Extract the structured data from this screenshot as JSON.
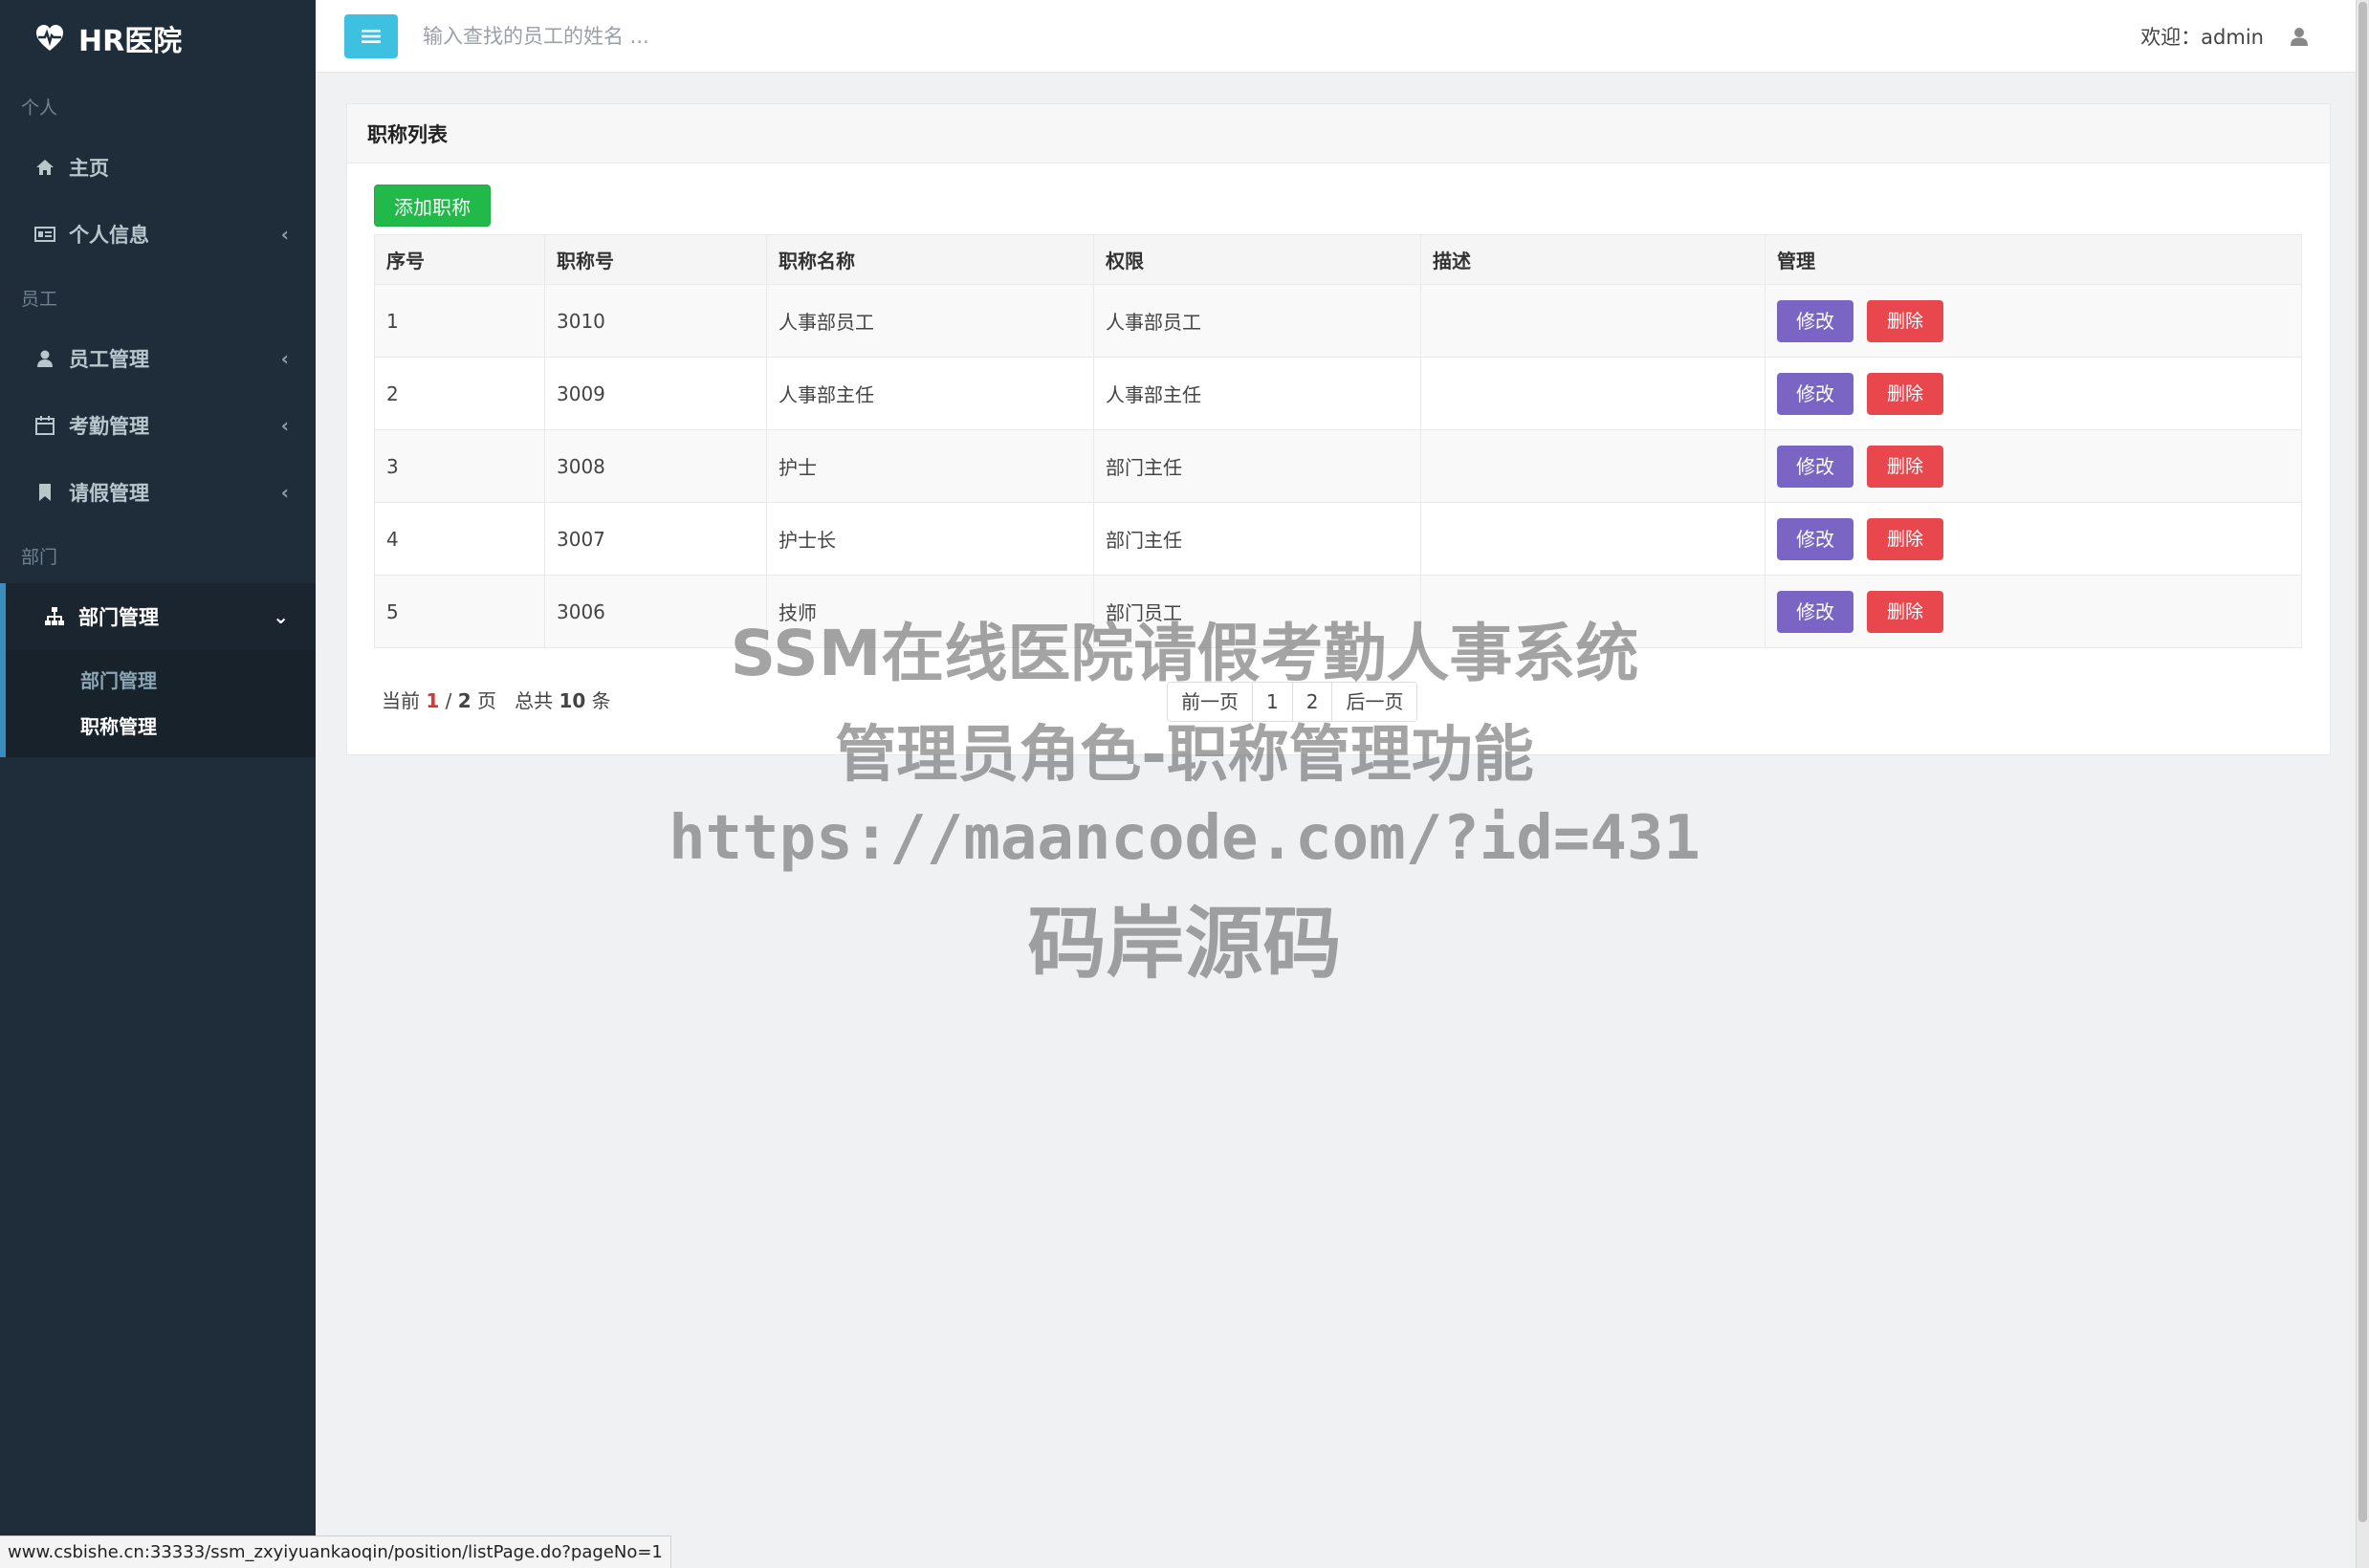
{
  "brand": {
    "title": "HR医院"
  },
  "sidebar": {
    "sections": [
      {
        "header": "个人",
        "items": [
          {
            "label": "主页"
          },
          {
            "label": "个人信息"
          }
        ]
      },
      {
        "header": "员工",
        "items": [
          {
            "label": "员工管理"
          },
          {
            "label": "考勤管理"
          },
          {
            "label": "请假管理"
          }
        ]
      },
      {
        "header": "部门",
        "items": [
          {
            "label": "部门管理"
          }
        ]
      }
    ],
    "submenu": [
      {
        "label": "部门管理"
      },
      {
        "label": "职称管理"
      }
    ]
  },
  "header": {
    "search_placeholder": "输入查找的员工的姓名 ...",
    "welcome": "欢迎：admin"
  },
  "box": {
    "title": "职称列表",
    "add_label": "添加职称"
  },
  "table": {
    "columns": [
      "序号",
      "职称号",
      "职称名称",
      "权限",
      "描述",
      "管理"
    ],
    "rows": [
      {
        "no": "1",
        "code": "3010",
        "name": "人事部员工",
        "role": "人事部员工",
        "desc": ""
      },
      {
        "no": "2",
        "code": "3009",
        "name": "人事部主任",
        "role": "人事部主任",
        "desc": ""
      },
      {
        "no": "3",
        "code": "3008",
        "name": "护士",
        "role": "部门主任",
        "desc": ""
      },
      {
        "no": "4",
        "code": "3007",
        "name": "护士长",
        "role": "部门主任",
        "desc": ""
      },
      {
        "no": "5",
        "code": "3006",
        "name": "技师",
        "role": "部门员工",
        "desc": ""
      }
    ],
    "edit_label": "修改",
    "delete_label": "删除"
  },
  "pagination": {
    "prefix": "当前",
    "current": "1",
    "sep": "/",
    "total_pages": "2",
    "page_word": "页",
    "total_prefix": "总共",
    "total_count": "10",
    "count_word": "条",
    "prev": "前一页",
    "pages": [
      "1",
      "2"
    ],
    "next": "后一页"
  },
  "watermark": {
    "line1": "SSM在线医院请假考勤人事系统",
    "line2": "管理员角色-职称管理功能",
    "line3": "https://maancode.com/?id=431",
    "line4": "码岸源码"
  },
  "status_url": "www.csbishe.cn:33333/ssm_zxyiyuankaoqin/position/listPage.do?pageNo=1",
  "colors": {
    "sidebar_bg": "#1f2d3a",
    "add_button": "#21b94a",
    "edit_button": "#7a64c4",
    "delete_button": "#e9474e",
    "toggle": "#3ec0e0"
  }
}
